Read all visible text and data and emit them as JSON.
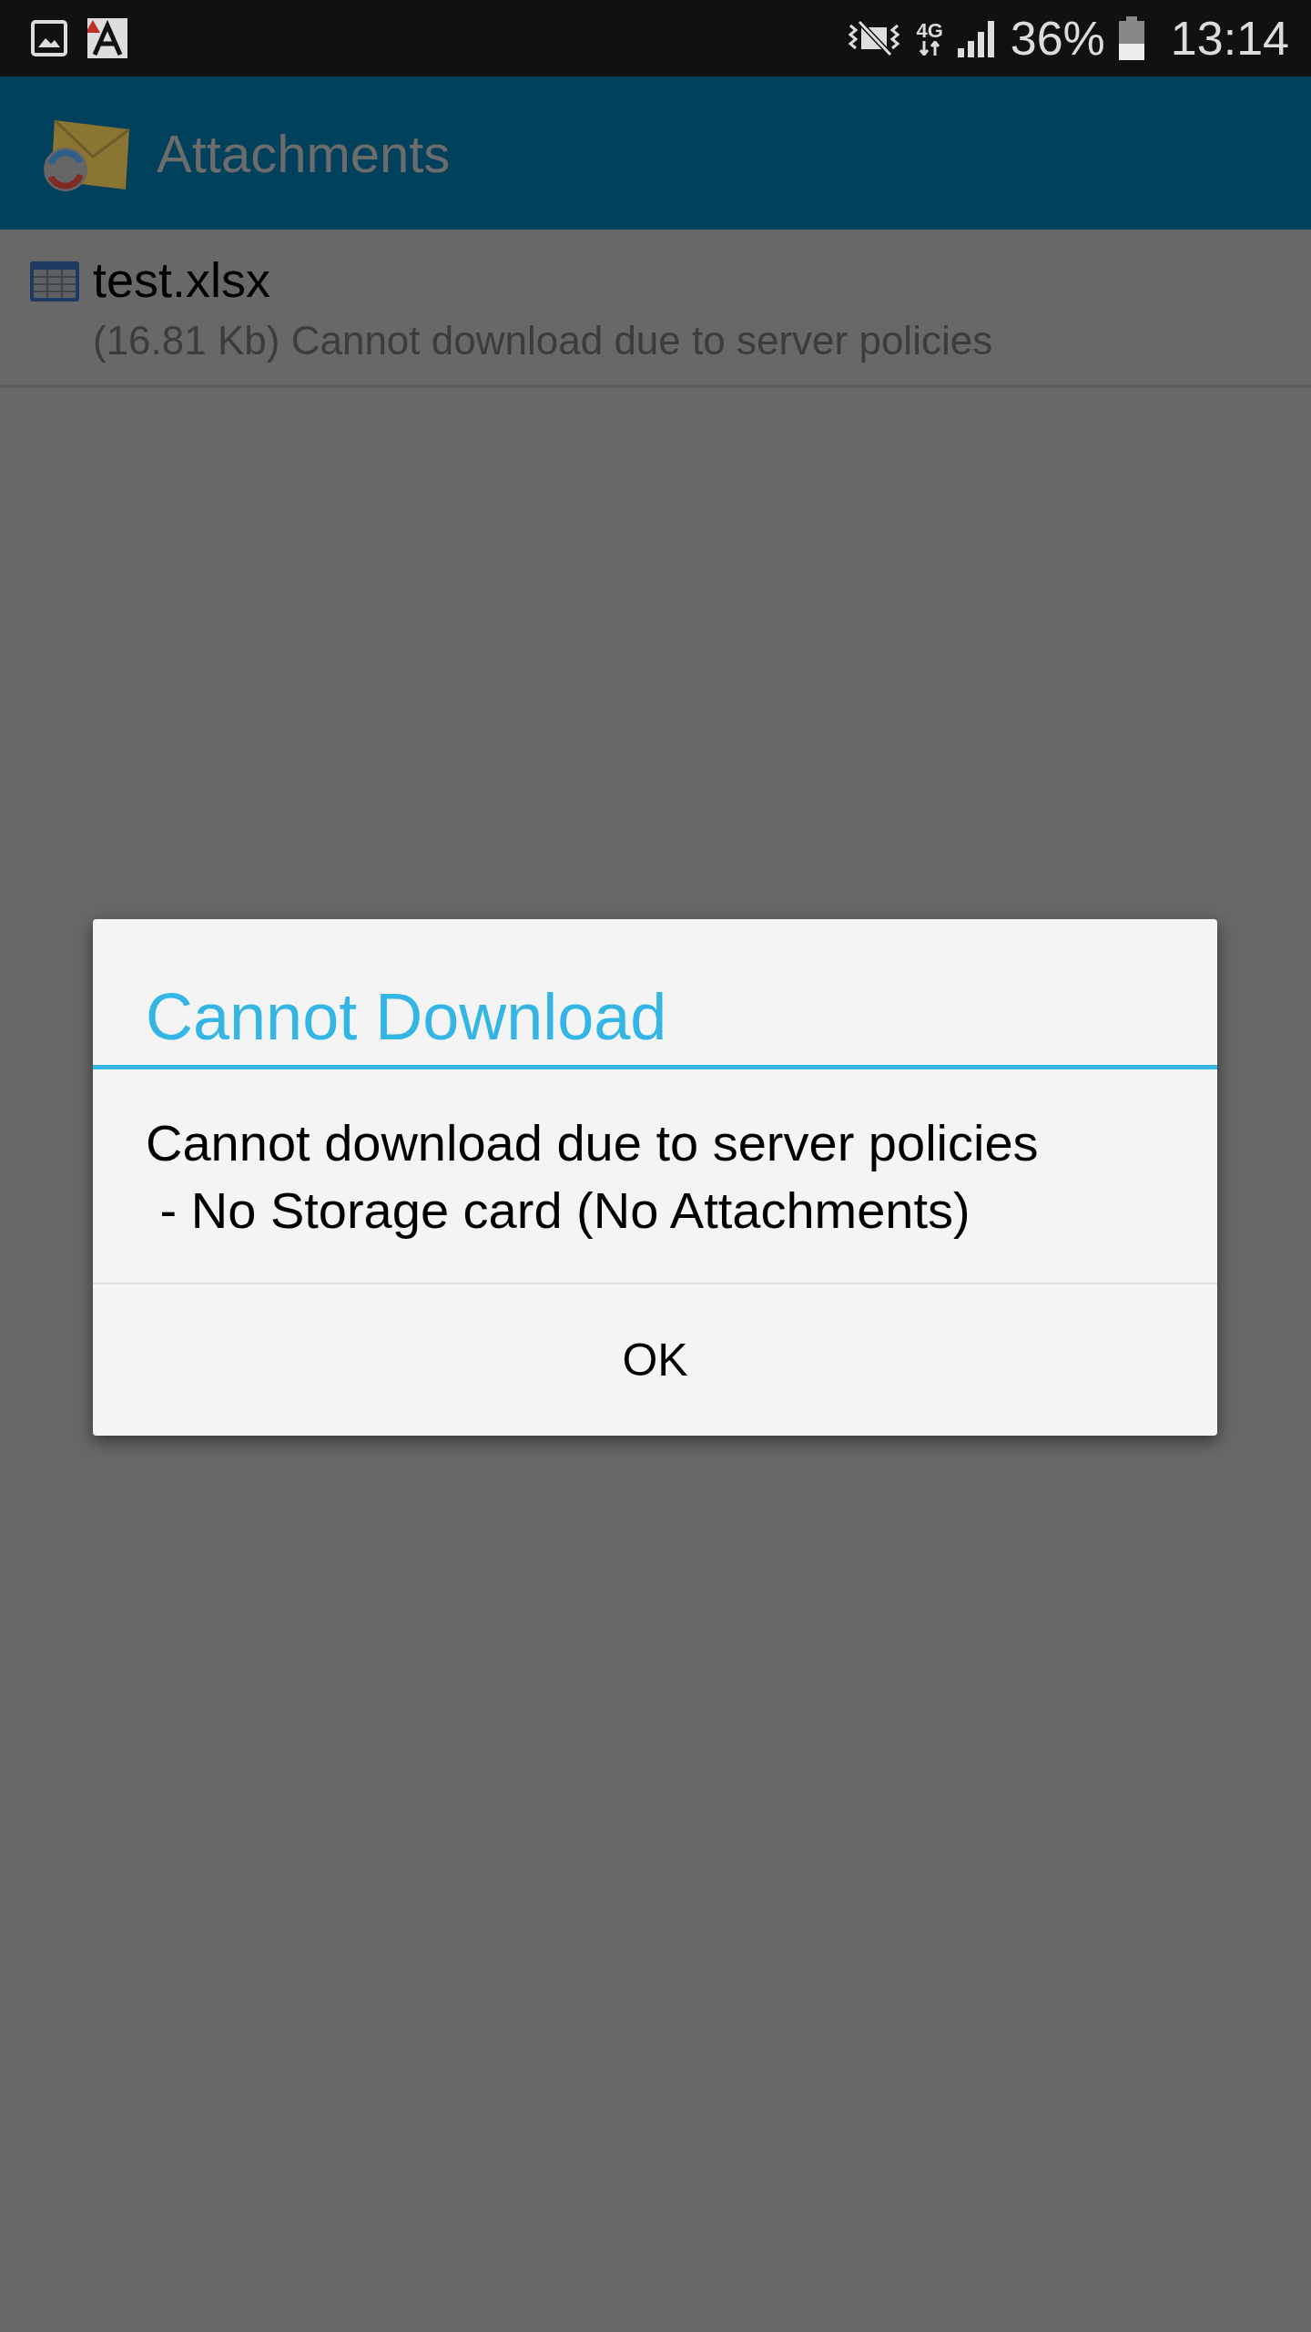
{
  "status_bar": {
    "network_type": "4G",
    "battery": "36%",
    "time": "13:14"
  },
  "app_bar": {
    "title": "Attachments"
  },
  "attachments": [
    {
      "name": "test.xlsx",
      "detail": "(16.81 Kb) Cannot download due to server policies"
    }
  ],
  "dialog": {
    "title": "Cannot Download",
    "message": "Cannot download due to server policies\n - No Storage card (No Attachments)",
    "buttons": [
      "OK"
    ]
  }
}
